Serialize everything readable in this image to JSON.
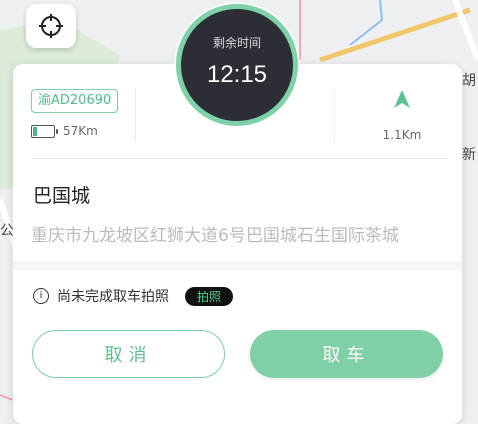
{
  "timer": {
    "label": "剩余时间",
    "value": "12:15"
  },
  "vehicle": {
    "plate": "渝AD20690",
    "battery_range": "57Km",
    "battery_level": 0.2
  },
  "distance": {
    "value": "1.1Km"
  },
  "location": {
    "name": "巴国城",
    "address": "重庆市九龙坡区红狮大道6号巴国城石生国际茶城"
  },
  "notice": {
    "text": "尚未完成取车拍照",
    "badge": "拍照"
  },
  "buttons": {
    "cancel": "取消",
    "pick_up": "取车"
  },
  "map": {
    "labels": [
      "胡",
      "新",
      "公"
    ]
  },
  "colors": {
    "accent": "#7fcfa7",
    "timer_bg": "#2b2e34"
  }
}
